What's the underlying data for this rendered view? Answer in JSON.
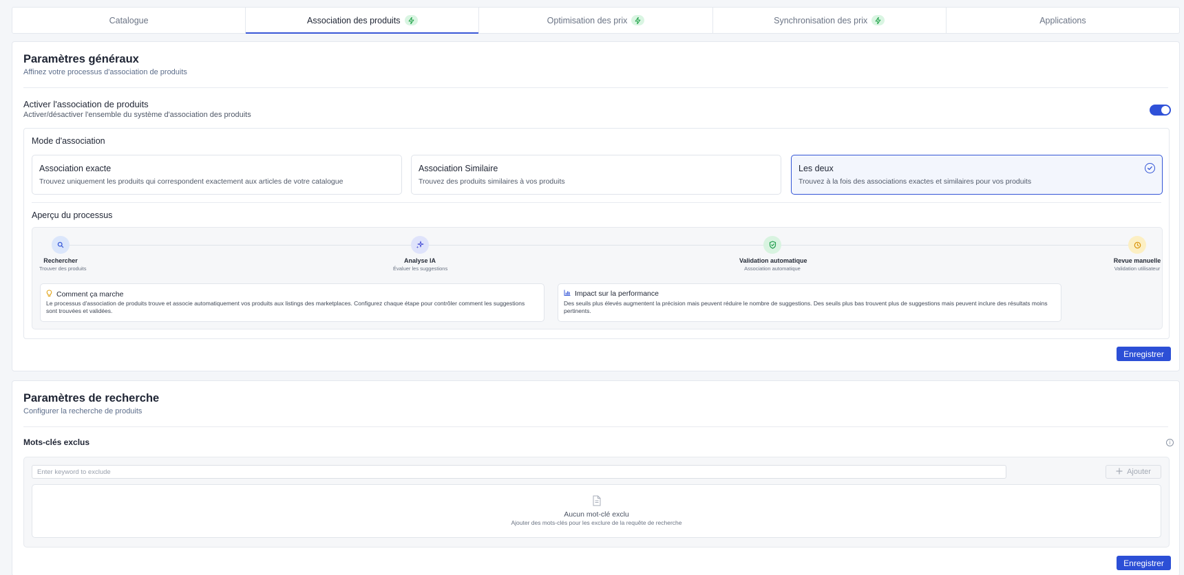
{
  "tabs": [
    {
      "label": "Catalogue",
      "active": false,
      "badge": false
    },
    {
      "label": "Association des produits",
      "active": true,
      "badge": true
    },
    {
      "label": "Optimisation des prix",
      "active": false,
      "badge": true
    },
    {
      "label": "Synchronisation des prix",
      "active": false,
      "badge": true
    },
    {
      "label": "Applications",
      "active": false,
      "badge": false
    }
  ],
  "general": {
    "title": "Paramètres généraux",
    "subtitle": "Affinez votre processus d'association de produits",
    "toggle_title": "Activer l'association de produits",
    "toggle_subtitle": "Activer/désactiver l'ensemble du système d'association des produits",
    "toggle_on": true,
    "mode_title": "Mode d'association",
    "modes": [
      {
        "title": "Association exacte",
        "desc": "Trouvez uniquement les produits qui correspondent exactement aux articles de votre catalogue",
        "selected": false
      },
      {
        "title": "Association Similaire",
        "desc": "Trouvez des produits similaires à vos produits",
        "selected": false
      },
      {
        "title": "Les deux",
        "desc": "Trouvez à la fois des associations exactes et similaires pour vos produits",
        "selected": true
      }
    ],
    "overview_title": "Aperçu du processus",
    "steps": [
      {
        "name": "Rechercher",
        "sub": "Trouver des produits",
        "icon": "search-icon"
      },
      {
        "name": "Analyse IA",
        "sub": "Évaluer les suggestions",
        "icon": "sparkles-icon"
      },
      {
        "name": "Validation automatique",
        "sub": "Association automatique",
        "icon": "shield-check-icon"
      },
      {
        "name": "Revue manuelle",
        "sub": "Validation utilisateur",
        "icon": "clock-icon"
      }
    ],
    "how_title": "Comment ça marche",
    "how_body": "Le processus d'association de produits trouve et associe automatiquement vos produits aux listings des marketplaces. Configurez chaque étape pour contrôler comment les suggestions sont trouvées et validées.",
    "impact_title": "Impact sur la performance",
    "impact_body": "Des seuils plus élevés augmentent la précision mais peuvent réduire le nombre de suggestions. Des seuils plus bas trouvent plus de suggestions mais peuvent inclure des résultats moins pertinents.",
    "save_label": "Enregistrer"
  },
  "search": {
    "title": "Paramètres de recherche",
    "subtitle": "Configurer la recherche de produits",
    "keywords_title": "Mots-clés exclus",
    "input_placeholder": "Enter keyword to exclude",
    "add_label": "Ajouter",
    "empty_title": "Aucun mot-clé exclu",
    "empty_desc": "Ajouter des mots-clés pour les exclure de la requête de recherche",
    "save_label": "Enregistrer"
  },
  "colors": {
    "accent": "#2c4fd6",
    "bolt_badge": "#d9f5e2"
  }
}
